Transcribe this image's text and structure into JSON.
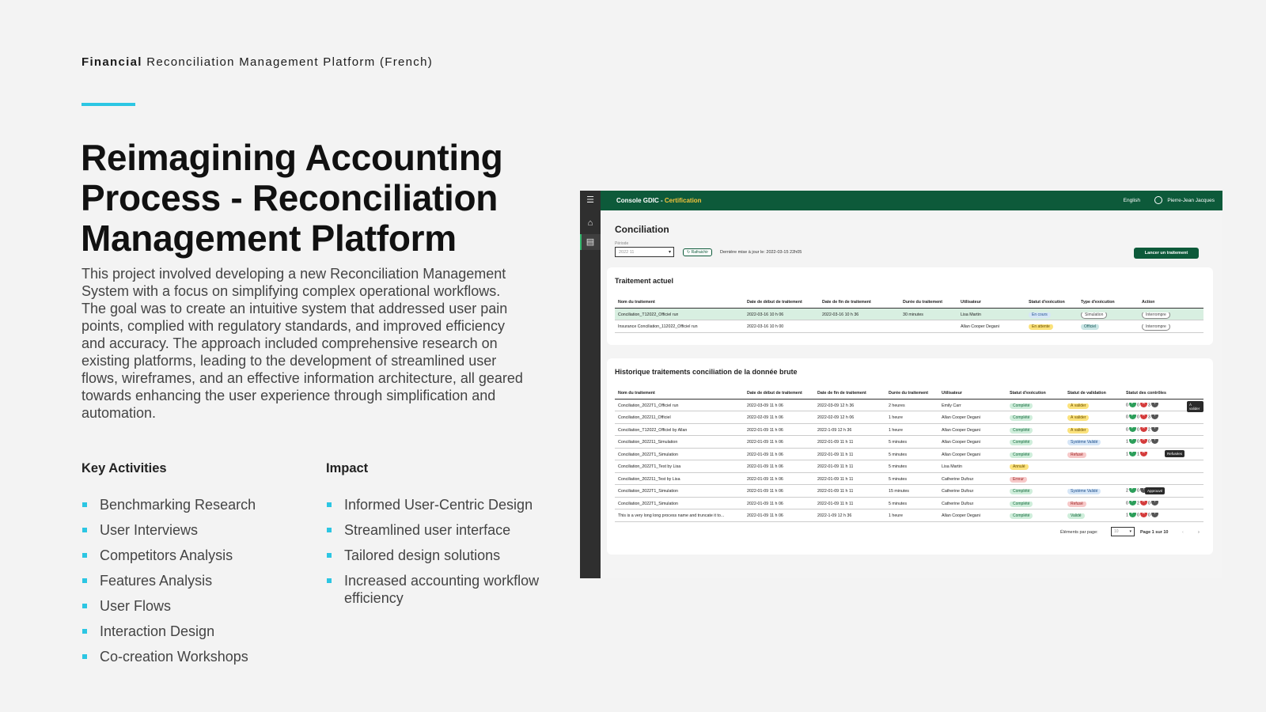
{
  "eyebrow": {
    "bold": "Financial",
    "rest": "Reconciliation Management Platform (French)"
  },
  "title": "Reimagining Accounting Process - Reconciliation Management Platform",
  "description": "This project involved developing a new Reconciliation Management System with a focus on simplifying complex operational workflows. The goal was to create an intuitive system that addressed user pain points, complied with regulatory standards, and improved efficiency and accuracy. The approach included comprehensive research on existing platforms, leading to the development of streamlined user flows, wireframes, and an effective information architecture, all geared towards enhancing the user experience through simplification and automation.",
  "key_activities": {
    "heading": "Key Activities",
    "items": [
      "Benchmarking Research",
      "User Interviews",
      "Competitors Analysis",
      "Features Analysis",
      "User Flows",
      "Interaction Design",
      "Co-creation Workshops"
    ]
  },
  "impact": {
    "heading": "Impact",
    "items": [
      "Informed User-Centric Design",
      "Streamlined user interface",
      "Tailored design solutions",
      "Increased accounting workflow efficiency"
    ]
  },
  "colors": {
    "accent": "#2cc6e3",
    "app_header": "#0d5a3a",
    "app_sidebar": "#2f2f2f",
    "certification": "#f1c23b"
  },
  "app": {
    "brand": "Console GDIC - ",
    "brand_highlight": "Certification",
    "language": "English",
    "user": "Pierre-Jean Jacques",
    "page_title": "Conciliation",
    "periode_label": "Période",
    "periode_value": "2022 11",
    "refresh_label": "Rafraichir",
    "last_update": "Dernière mise à jour le: 2022-03-15 22h05",
    "launch_button": "Lancer un traitement",
    "current": {
      "title": "Traitement actuel",
      "headers": [
        "Nom du traitement",
        "Date de début de traitement",
        "Date de fin de traitement",
        "Durée du traitement",
        "Utilisateur",
        "Statut d'exécution",
        "Type d'exécution",
        "Action"
      ],
      "rows": [
        [
          "Conciliation_T12022_Officiel run",
          "2022-03-16 10 h 06",
          "2022-03-16 10 h 36",
          "30 minutes",
          "Lisa Martin",
          "En cours",
          "Simulation",
          "Interrompre"
        ],
        [
          "Insurance Conciliation_112022_Officiel run",
          "2022-03-16 10 h 00",
          "",
          "",
          "Allan Cooper Degani",
          "En attente",
          "Officiel",
          "Interrompre"
        ]
      ]
    },
    "history": {
      "title": "Historique traitements conciliation de la donnée brute",
      "headers": [
        "Nom du traitement",
        "Date de début de traitement",
        "Date de fin de traitement",
        "Durée du traitement",
        "Utilisateur",
        "Statut d'exécution",
        "Statut de validation",
        "Statut des contrôles"
      ],
      "rows": [
        [
          "Conciliation_2022T1_Officiel run",
          "2022-03-09 11 h 06",
          "2022-03-09 12 h 36",
          "2 heures",
          "Emily Carr",
          "Complété",
          "À valider",
          "0",
          "0",
          "3"
        ],
        [
          "Conciliation_202211_Officiel",
          "2022-02-09 11 h 06",
          "2022-02-09 12 h 06",
          "1 heure",
          "Allan Cooper Degani",
          "Complété",
          "À valider",
          "0",
          "0",
          "3"
        ],
        [
          "Conciliation_T12022_Officiel by Allan",
          "2022-01-09 11 h 06",
          "2022-1-09 12 h 36",
          "1 heure",
          "Allan Cooper Degani",
          "Complété",
          "À valider",
          "0",
          "0",
          "2"
        ],
        [
          "Conciliation_202211_Simulation",
          "2022-01-09 11 h 06",
          "2022-01-09 11 h 11",
          "5 minutes",
          "Allan Cooper Degani",
          "Complété",
          "Système Validé",
          "1",
          "0",
          "0"
        ],
        [
          "Conciliation_2022T1_Simulation",
          "2022-01-09 11 h 06",
          "2022-01-09 11 h 11",
          "5 minutes",
          "Allan Cooper Degani",
          "Complété",
          "Refusé",
          "1",
          "1",
          ""
        ],
        [
          "Conciliation_2022T1_Test by Lisa",
          "2022-01-09 11 h 06",
          "2022-01-09 11 h 11",
          "5 minutes",
          "Lisa Martin",
          "Annulé",
          "",
          "",
          "",
          ""
        ],
        [
          "Conciliation_202211_Test by Lisa",
          "2022-01-09 11 h 06",
          "2022-01-09 11 h 11",
          "5 minutes",
          "Catherine Dufour",
          "Erreur",
          "",
          "",
          "",
          ""
        ],
        [
          "Conciliation_2022T1_Simulation",
          "2022-01-09 11 h 06",
          "2022-01-09 11 h 11",
          "15 minutes",
          "Catherine Dufour",
          "Complété",
          "Système Validé",
          "2",
          "",
          "0"
        ],
        [
          "Conciliation_2022T1_Simulation",
          "2022-01-09 11 h 06",
          "2022-01-09 11 h 11",
          "5 minutes",
          "Catherine Dufour",
          "Complété",
          "Refusé",
          "0",
          "2",
          "0"
        ],
        [
          "This is a very long long process name and truncate it to...",
          "2022-01-09 11 h 06",
          "2022-1-09 12 h 36",
          "1 heure",
          "Allan Cooper Degani",
          "Complété",
          "Validé",
          "1",
          "0",
          "0"
        ]
      ],
      "tooltips": [
        "À valider",
        "Refusées",
        "Approuvé"
      ],
      "items_per_page_label": "Éléments par page:",
      "items_per_page_value": "10",
      "page_label": "Page 1 sur 10"
    }
  }
}
